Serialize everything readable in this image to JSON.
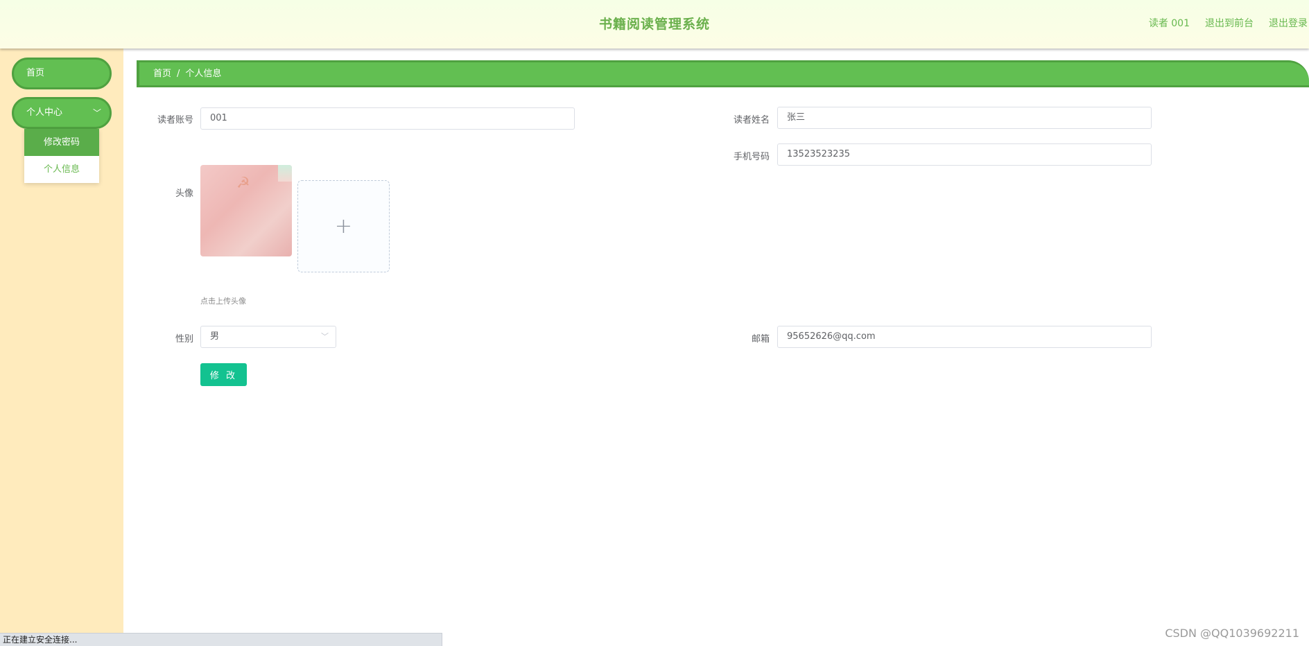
{
  "header": {
    "title": "书籍阅读管理系统",
    "user": "读者 001",
    "back_to_front": "退出到前台",
    "logout": "退出登录"
  },
  "sidebar": {
    "home": "首页",
    "personal_center": "个人中心",
    "submenu": [
      {
        "label": "修改密码",
        "active": true
      },
      {
        "label": "个人信息",
        "active": false
      }
    ]
  },
  "breadcrumb": {
    "home": "首页",
    "separator": "/",
    "current": "个人信息"
  },
  "form": {
    "account_label": "读者账号",
    "account_value": "001",
    "name_label": "读者姓名",
    "name_value": "张三",
    "phone_label": "手机号码",
    "phone_value": "13523523235",
    "avatar_label": "头像",
    "upload_tip": "点击上传头像",
    "gender_label": "性别",
    "gender_value": "男",
    "email_label": "邮箱",
    "email_value": "95652626@qq.com",
    "submit_label": "修 改"
  },
  "status_bar": "正在建立安全连接...",
  "watermark": "CSDN @QQ1039692211",
  "colors": {
    "accent_green": "#62bf52",
    "submit_teal": "#13c290",
    "sidebar_bg": "#ffebbd"
  }
}
